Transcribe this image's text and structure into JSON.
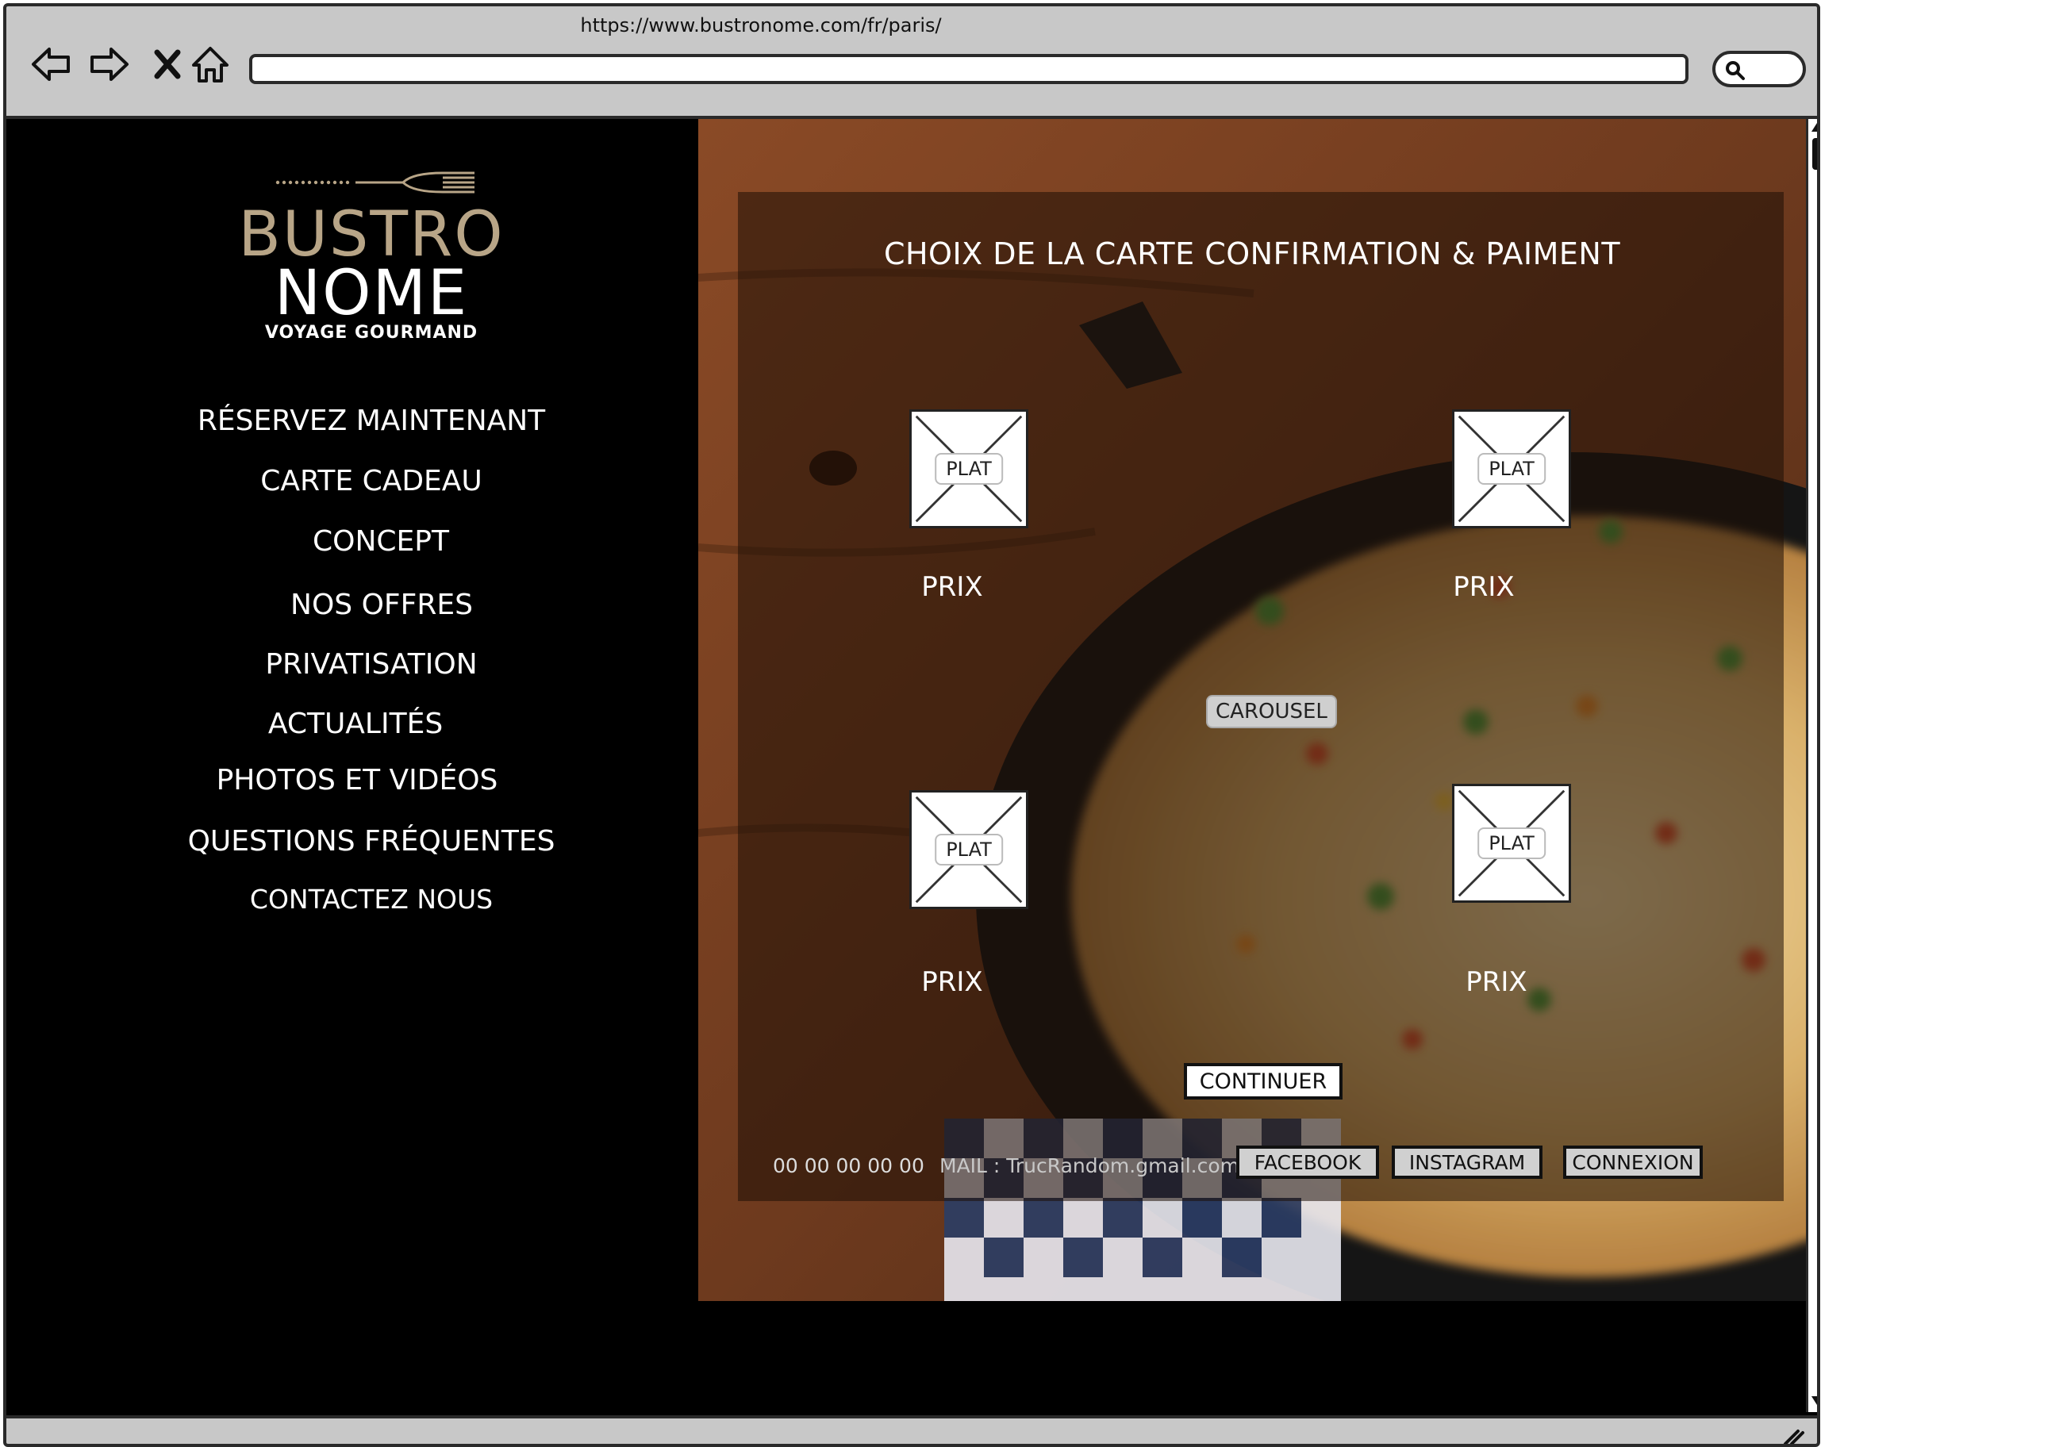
{
  "browser": {
    "url": "https://www.bustronome.com/fr/paris/"
  },
  "logo": {
    "line1": "BUSTRO",
    "line2": "NOME",
    "tagline": "VOYAGE GOURMAND"
  },
  "sidebar": {
    "items": [
      {
        "label": "RÉSERVEZ MAINTENANT"
      },
      {
        "label": "CARTE CADEAU"
      },
      {
        "label": "CONCEPT"
      },
      {
        "label": "NOS OFFRES"
      },
      {
        "label": "PRIVATISATION"
      },
      {
        "label": "ACTUALITÉS"
      },
      {
        "label": "PHOTOS ET VIDÉOS"
      },
      {
        "label": "QUESTIONS FRÉQUENTES"
      },
      {
        "label": "CONTACTEZ NOUS"
      }
    ]
  },
  "main": {
    "title": "CHOIX DE LA CARTE CONFIRMATION & PAIMENT",
    "dishes": [
      {
        "image_label": "PLAT",
        "price_label": "PRIX"
      },
      {
        "image_label": "PLAT",
        "price_label": "PRIX"
      },
      {
        "image_label": "PLAT",
        "price_label": "PRIX"
      },
      {
        "image_label": "PLAT",
        "price_label": "PRIX"
      }
    ],
    "carousel_label": "CAROUSEL",
    "continue_label": "CONTINUER"
  },
  "footer": {
    "phone": "00 00 00 00 00",
    "mail": "MAIL : TrucRandom.gmail.com",
    "facebook": "FACEBOOK",
    "instagram": "INSTAGRAM",
    "connexion": "CONNEXION"
  },
  "colors": {
    "gold": "#b8a587",
    "overlay": "#1e0e06"
  }
}
